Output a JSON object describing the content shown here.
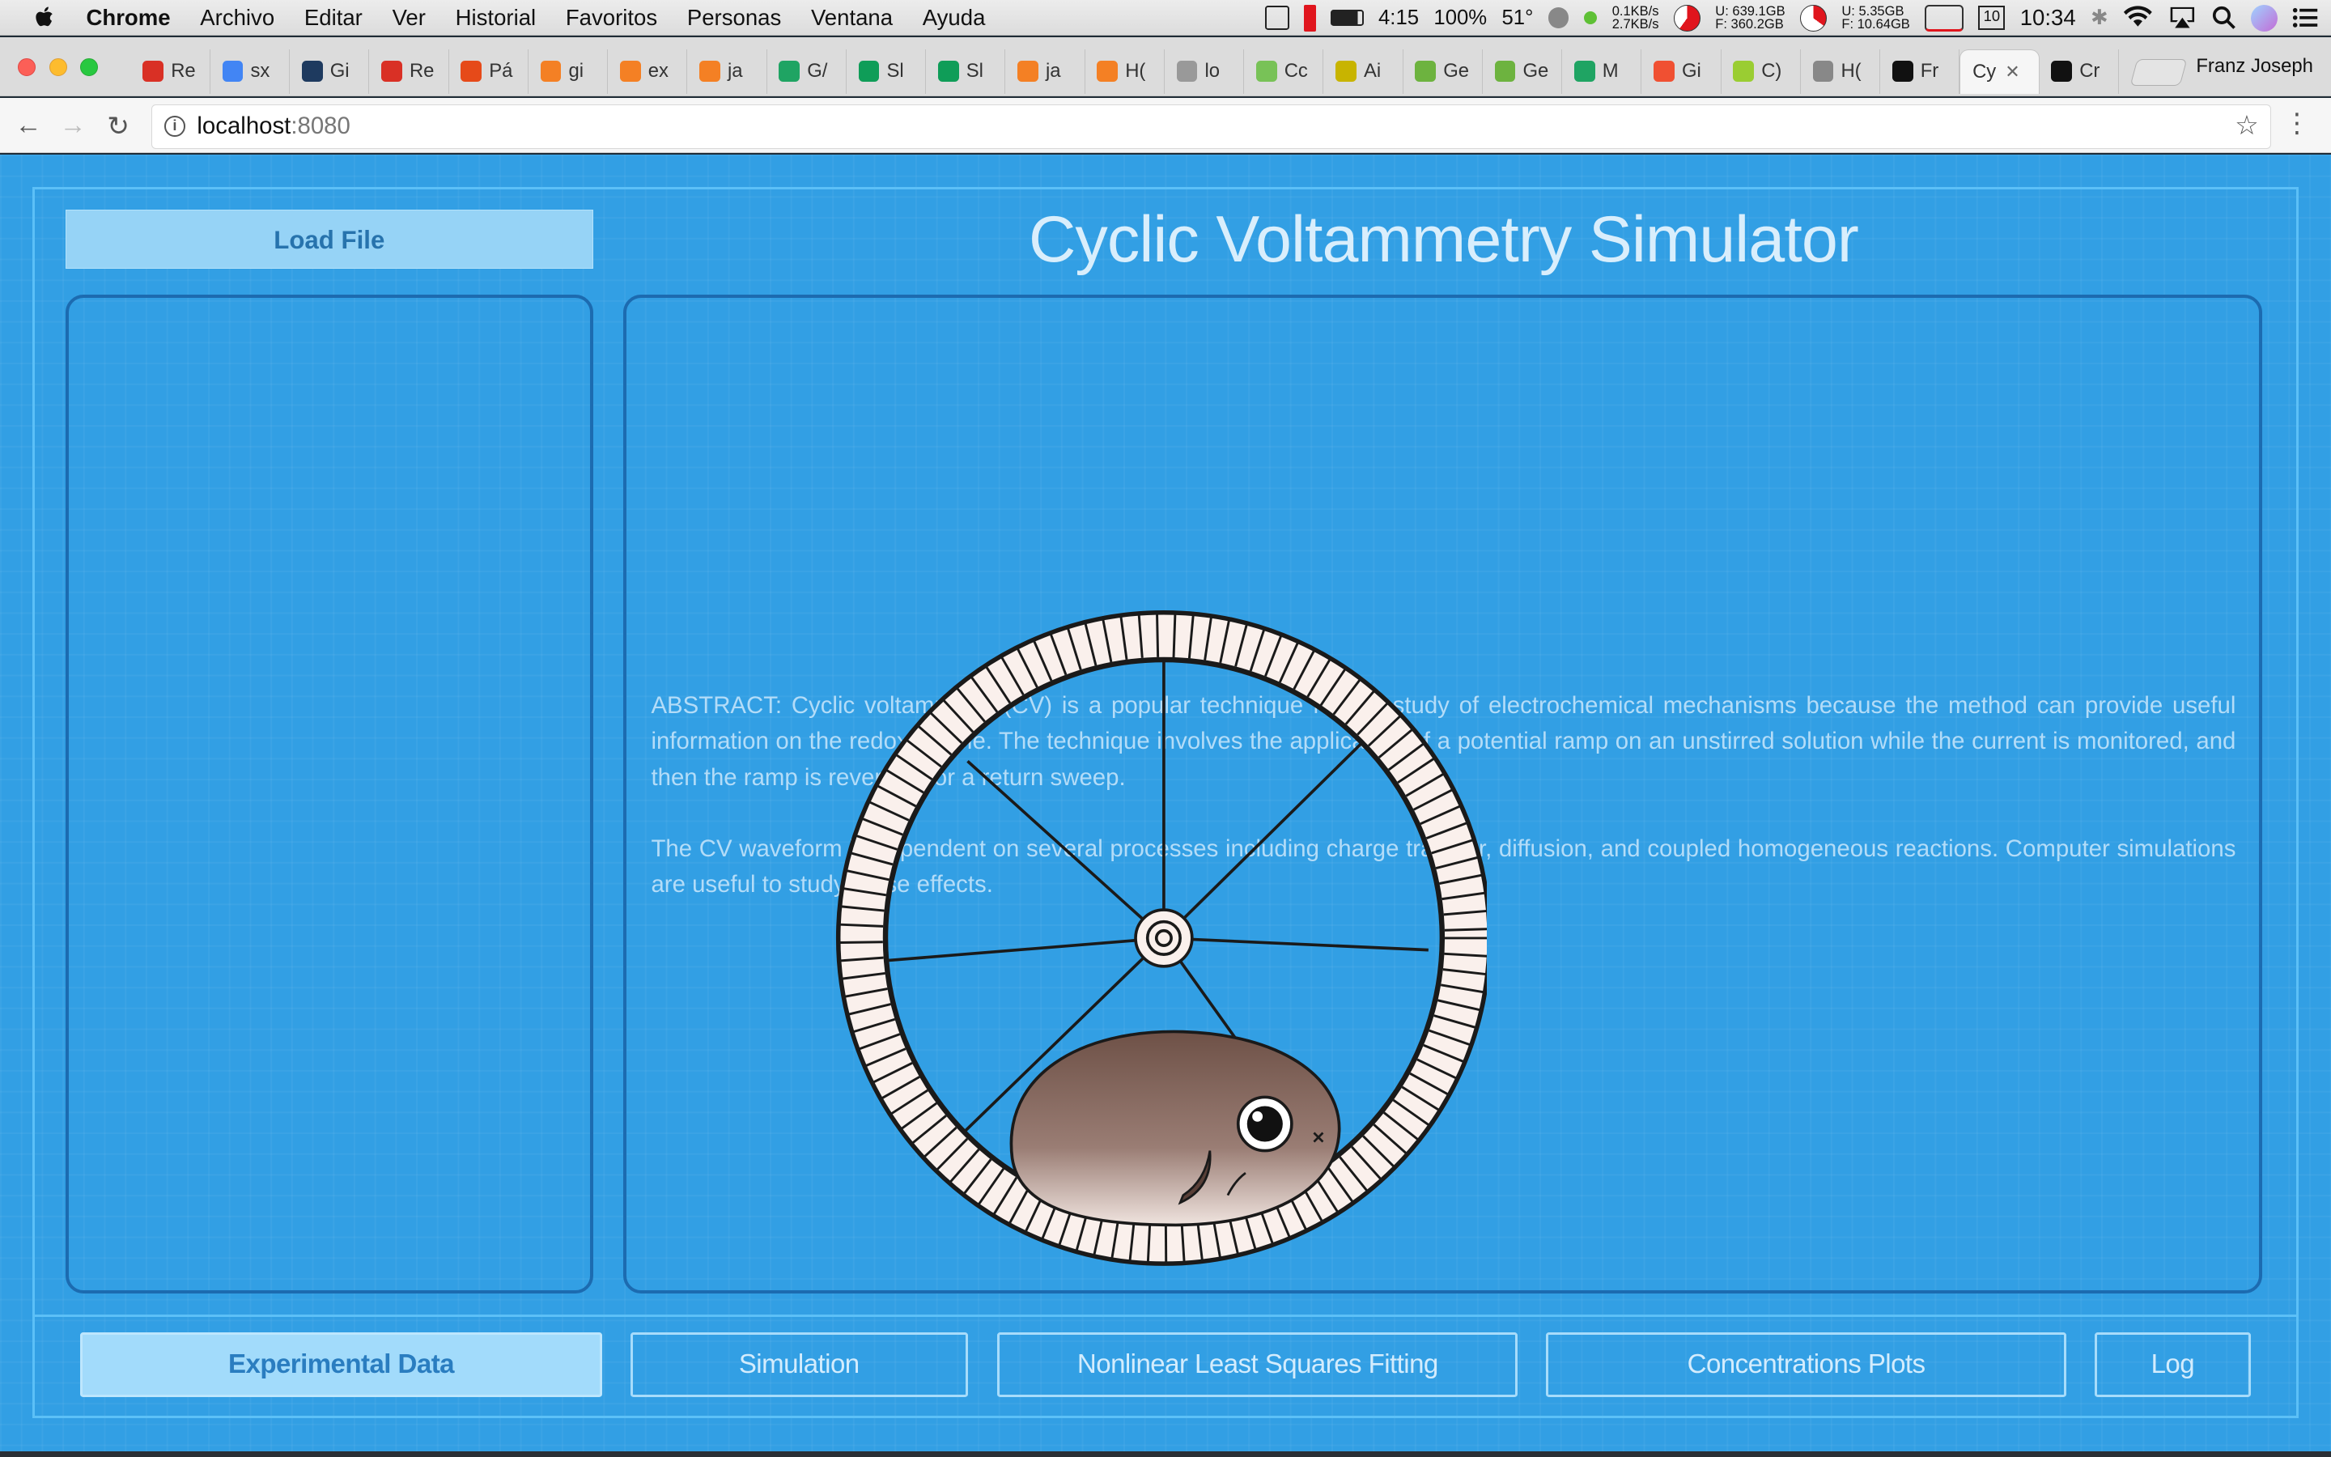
{
  "menubar": {
    "app_name": "Chrome",
    "menus": [
      "Archivo",
      "Editar",
      "Ver",
      "Historial",
      "Favoritos",
      "Personas",
      "Ventana",
      "Ayuda"
    ],
    "status": {
      "battery": "4:15",
      "battery_pct": "100%",
      "temp": "51°",
      "net_up": "0.1KB/s",
      "net_down": "2.7KB/s",
      "disk1_u": "U: 639.1GB",
      "disk1_f": "F: 360.2GB",
      "disk2_u": "U:  5.35GB",
      "disk2_f": "F: 10.64GB",
      "calendar_day": "10",
      "clock": "10:34"
    }
  },
  "tabs": [
    {
      "label": "Re",
      "color": "#d93025"
    },
    {
      "label": "sx",
      "color": "#4285f4"
    },
    {
      "label": "Gi",
      "color": "#1e3a5f"
    },
    {
      "label": "Re",
      "color": "#d93025"
    },
    {
      "label": "Pá",
      "color": "#e64a19"
    },
    {
      "label": "gi",
      "color": "#f48024"
    },
    {
      "label": "ex",
      "color": "#f48024"
    },
    {
      "label": "ja",
      "color": "#f48024"
    },
    {
      "label": "G/",
      "color": "#1fa463"
    },
    {
      "label": "Sl",
      "color": "#0f9d58"
    },
    {
      "label": "Sl",
      "color": "#0f9d58"
    },
    {
      "label": "ja",
      "color": "#f48024"
    },
    {
      "label": "H(",
      "color": "#f48024"
    },
    {
      "label": "lo",
      "color": "#999999"
    },
    {
      "label": "Cc",
      "color": "#78c257"
    },
    {
      "label": "Ai",
      "color": "#c8b400"
    },
    {
      "label": "Ge",
      "color": "#6db33f"
    },
    {
      "label": "Ge",
      "color": "#6db33f"
    },
    {
      "label": "M",
      "color": "#1fa463"
    },
    {
      "label": "Gi",
      "color": "#f05032"
    },
    {
      "label": "C)",
      "color": "#9acd32"
    },
    {
      "label": "H(",
      "color": "#888888"
    },
    {
      "label": "Fr",
      "color": "#111111"
    },
    {
      "label": "Cy",
      "color": "#f6f6f6"
    },
    {
      "label": "Cr",
      "color": "#111111"
    }
  ],
  "active_tab_index": 23,
  "profile_name": "Franz Joseph",
  "address": {
    "host": "localhost",
    "port": ":8080"
  },
  "app": {
    "load_button": "Load File",
    "title": "Cyclic Voltammetry Simulator",
    "abstract_p1": "ABSTRACT: Cyclic voltammetry (CV) is a popular technique for the study of electrochemical mechanisms because the method can provide useful information on the redox couple. The technique involves the application of a potential ramp on an unstirred solution while the current is monitored, and then the ramp is reversed for a return sweep.",
    "abstract_p2": "The CV waveform is dependent on several processes including charge transfer, diffusion, and coupled homogeneous reactions. Computer simulations are useful to study these effects.",
    "nav": [
      {
        "label": "Experimental Data",
        "active": true
      },
      {
        "label": "Simulation",
        "active": false
      },
      {
        "label": "Nonlinear Least Squares Fitting",
        "active": false
      },
      {
        "label": "Concentrations Plots",
        "active": false
      },
      {
        "label": "Log",
        "active": false
      }
    ],
    "loading_graphic": "hamster-wheel-icon"
  }
}
